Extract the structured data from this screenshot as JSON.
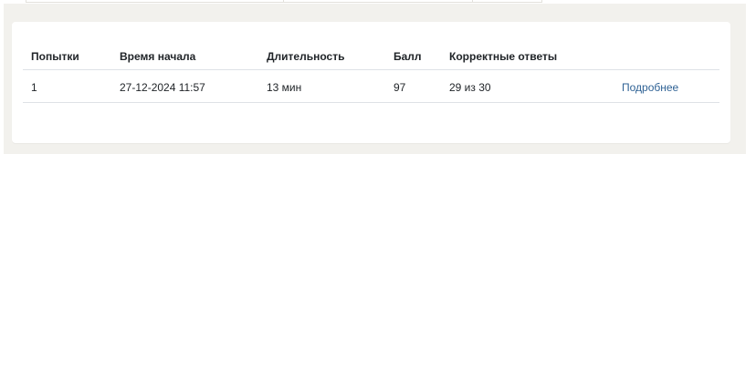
{
  "attempts_table": {
    "columns": {
      "attempt": "Попытки",
      "start_time": "Время начала",
      "duration": "Длительность",
      "score": "Балл",
      "correct": "Корректные ответы"
    },
    "rows": [
      {
        "attempt": "1",
        "start_time": "27-12-2024 11:57",
        "duration": "13 мин",
        "score": "97",
        "correct": "29 из 30",
        "details_link": "Подробнее"
      }
    ]
  }
}
